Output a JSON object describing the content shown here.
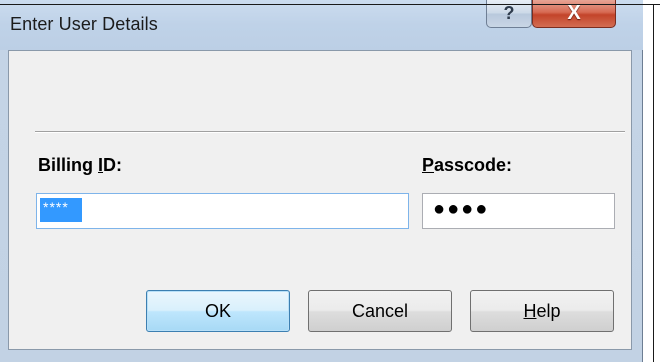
{
  "background": {
    "fragment_text": "."
  },
  "dialog": {
    "title": "Enter User Details",
    "titlebar_help_glyph": "?",
    "titlebar_close_glyph": "X",
    "billing_label_pre": "Billing ",
    "billing_label_mnemonic": "I",
    "billing_label_post": "D:",
    "billing_value": "****",
    "passcode_label_mnemonic": "P",
    "passcode_label_post": "asscode:",
    "passcode_value": "●●●●",
    "ok_label": "OK",
    "cancel_label": "Cancel",
    "help_label_mnemonic": "H",
    "help_label_post": "elp"
  },
  "colors": {
    "selection": "#3399ff",
    "close_button": "#c3442a",
    "titlebar": "#bfd2e8",
    "dialog_face": "#f0f0f0"
  },
  "icons": [
    "help-icon",
    "close-icon"
  ]
}
